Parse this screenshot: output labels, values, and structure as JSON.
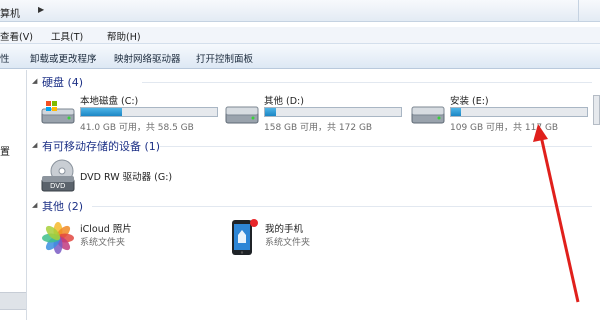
{
  "address": {
    "crumb": "算机"
  },
  "menu": {
    "view": "查看(V)",
    "tools": "工具(T)",
    "help": "帮助(H)"
  },
  "toolbar": {
    "properties": "性",
    "uninstall": "卸载或更改程序",
    "map_drive": "映射网络驱动器",
    "control_panel": "打开控制面板"
  },
  "nav": {
    "partial_label": "置"
  },
  "groups": {
    "hard_disks": "硬盘 (4)",
    "removable": "有可移动存储的设备 (1)",
    "other": "其他 (2)"
  },
  "drives": [
    {
      "name": "本地磁盘 (C:)",
      "free": "41.0 GB 可用，共 58.5 GB",
      "used_fraction": 0.3
    },
    {
      "name": "其他 (D:)",
      "free": "158 GB 可用，共 172 GB",
      "used_fraction": 0.08
    },
    {
      "name": "安装 (E:)",
      "free": "109 GB 可用，共 117 GB",
      "used_fraction": 0.07
    }
  ],
  "dvd": {
    "name": "DVD RW 驱动器 (G:)",
    "icon_label": "DVD"
  },
  "other_items": [
    {
      "name": "iCloud 照片",
      "type": "系统文件夹"
    },
    {
      "name": "我的手机",
      "type": "系统文件夹"
    }
  ],
  "colors": {
    "accent_group": "#1e3287",
    "bar_fill": "#1b86c5",
    "arrow": "#e0201c"
  }
}
